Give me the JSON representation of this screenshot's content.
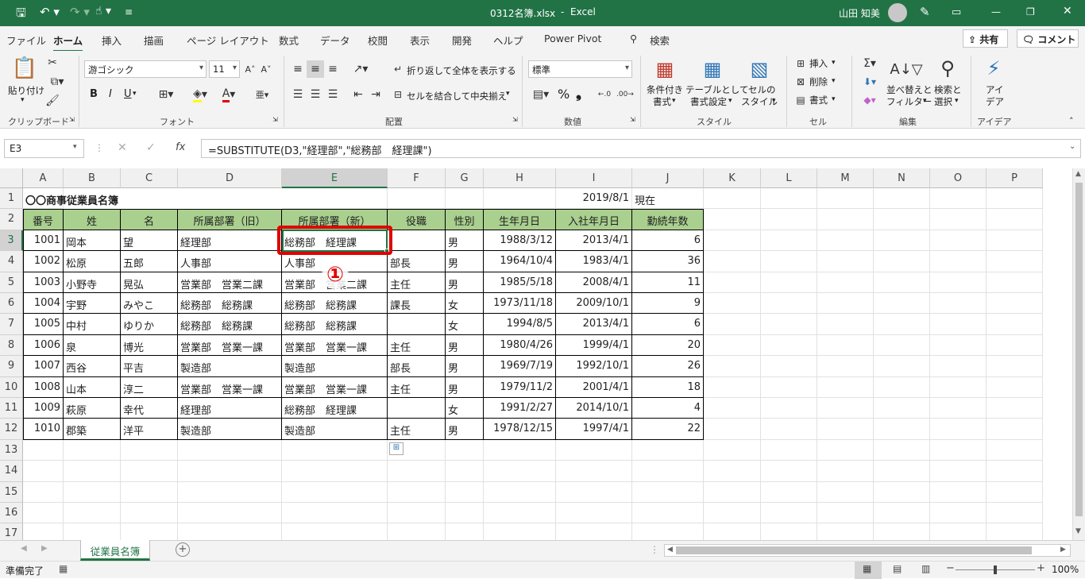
{
  "title": {
    "file": "0312名簿.xlsx",
    "app": "Excel",
    "sep": "-",
    "user": "山田 知美"
  },
  "tabs": [
    "ファイル",
    "ホーム",
    "挿入",
    "描画",
    "ページ レイアウト",
    "数式",
    "データ",
    "校閲",
    "表示",
    "開発",
    "ヘルプ",
    "Power Pivot",
    "検索"
  ],
  "share_label": "共有",
  "comment_label": "コメント",
  "ribbon": {
    "clipboard": {
      "paste": "貼り付け",
      "group": "クリップボード"
    },
    "font": {
      "name": "游ゴシック",
      "size": "11",
      "bold": "B",
      "italic": "I",
      "underline": "U",
      "group": "フォント"
    },
    "align": {
      "wrap": "折り返して全体を表示する",
      "merge": "セルを結合して中央揃え",
      "group": "配置"
    },
    "number": {
      "format": "標準",
      "percent": "%",
      "comma": "❟",
      "group": "数値"
    },
    "styles": {
      "cond": "条件付き",
      "cond2": "書式",
      "table": "テーブルとして",
      "table2": "書式設定",
      "cell": "セルの",
      "cell2": "スタイル",
      "group": "スタイル"
    },
    "cells": {
      "insert": "挿入",
      "delete": "削除",
      "format": "書式",
      "group": "セル"
    },
    "edit": {
      "sort": "並べ替えと",
      "sort2": "フィルター",
      "find": "検索と",
      "find2": "選択",
      "group": "編集"
    },
    "ideas": {
      "label": "アイ",
      "label2": "デア",
      "group": "アイデア"
    }
  },
  "formula_bar": {
    "name_box": "E3",
    "fx": "fx",
    "formula": "=SUBSTITUTE(D3,\"経理部\",\"総務部　経理課\")"
  },
  "columns": [
    "A",
    "B",
    "C",
    "D",
    "E",
    "F",
    "G",
    "H",
    "I",
    "J",
    "K",
    "L",
    "M",
    "N",
    "O",
    "P"
  ],
  "rows": [
    "1",
    "2",
    "3",
    "4",
    "5",
    "6",
    "7",
    "8",
    "9",
    "10",
    "11",
    "12",
    "13",
    "14",
    "15",
    "16",
    "17"
  ],
  "sheet_title": "〇〇商事従業員名簿",
  "as_of_date": "2019/8/1",
  "as_of_label": "現在",
  "headers": [
    "番号",
    "姓",
    "名",
    "所属部署（旧）",
    "所属部署（新）",
    "役職",
    "性別",
    "生年月日",
    "入社年月日",
    "勤続年数"
  ],
  "table": [
    [
      "1001",
      "岡本",
      "望",
      "経理部",
      "総務部　経理課",
      "",
      "男",
      "1988/3/12",
      "2013/4/1",
      "6"
    ],
    [
      "1002",
      "松原",
      "五郎",
      "人事部",
      "人事部",
      "部長",
      "男",
      "1964/10/4",
      "1983/4/1",
      "36"
    ],
    [
      "1003",
      "小野寺",
      "晃弘",
      "営業部　営業二課",
      "営業部　営業二課",
      "主任",
      "男",
      "1985/5/18",
      "2008/4/1",
      "11"
    ],
    [
      "1004",
      "宇野",
      "みやこ",
      "総務部　総務課",
      "総務部　総務課",
      "課長",
      "女",
      "1973/11/18",
      "2009/10/1",
      "9"
    ],
    [
      "1005",
      "中村",
      "ゆりか",
      "総務部　総務課",
      "総務部　総務課",
      "",
      "女",
      "1994/8/5",
      "2013/4/1",
      "6"
    ],
    [
      "1006",
      "泉",
      "博光",
      "営業部　営業一課",
      "営業部　営業一課",
      "主任",
      "男",
      "1980/4/26",
      "1999/4/1",
      "20"
    ],
    [
      "1007",
      "西谷",
      "平吉",
      "製造部",
      "製造部",
      "部長",
      "男",
      "1969/7/19",
      "1992/10/1",
      "26"
    ],
    [
      "1008",
      "山本",
      "淳二",
      "営業部　営業一課",
      "営業部　営業一課",
      "主任",
      "男",
      "1979/11/2",
      "2001/4/1",
      "18"
    ],
    [
      "1009",
      "萩原",
      "幸代",
      "経理部",
      "総務部　経理課",
      "",
      "女",
      "1991/2/27",
      "2014/10/1",
      "4"
    ],
    [
      "1010",
      "郡築",
      "洋平",
      "製造部",
      "製造部",
      "主任",
      "男",
      "1978/12/15",
      "1997/4/1",
      "22"
    ]
  ],
  "callout": "①",
  "sheet_tab": "従業員名簿",
  "status": {
    "ready": "準備完了",
    "zoom": "100%"
  },
  "colors": {
    "excel_green": "#217346",
    "header_fill": "#a9d08e",
    "callout_red": "#e00000"
  }
}
